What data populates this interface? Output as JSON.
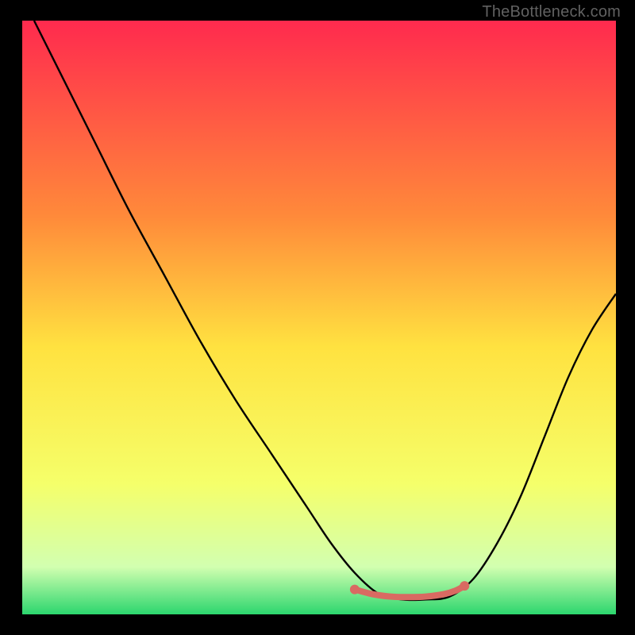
{
  "attribution": "TheBottleneck.com",
  "colors": {
    "bg": "#000000",
    "text": "#616161",
    "gradient_top": "#ff2a4e",
    "gradient_mid_upper": "#ff8a3a",
    "gradient_mid": "#ffe240",
    "gradient_mid_lower": "#f5ff6a",
    "gradient_lower": "#d2ffb0",
    "gradient_bottom": "#2cd66e",
    "curve": "#000000",
    "marker": "#d96a62"
  },
  "chart_data": {
    "type": "line",
    "title": "",
    "xlabel": "",
    "ylabel": "",
    "xlim": [
      0,
      100
    ],
    "ylim": [
      0,
      100
    ],
    "series": [
      {
        "name": "bottleneck-curve",
        "x": [
          2,
          6,
          12,
          18,
          24,
          30,
          36,
          42,
          48,
          52,
          56,
          60,
          64,
          68,
          72,
          76,
          80,
          84,
          88,
          92,
          96,
          100
        ],
        "y": [
          100,
          92,
          80,
          68,
          57,
          46,
          36,
          27,
          18,
          12,
          7,
          3.5,
          2.5,
          2.5,
          3,
          6,
          12,
          20,
          30,
          40,
          48,
          54
        ]
      }
    ],
    "markers": {
      "name": "optimal-range",
      "x": [
        56,
        59,
        62,
        65,
        68,
        71,
        73,
        74.5
      ],
      "y": [
        4.2,
        3.4,
        3.0,
        2.9,
        3.0,
        3.4,
        4.0,
        4.8
      ]
    }
  }
}
